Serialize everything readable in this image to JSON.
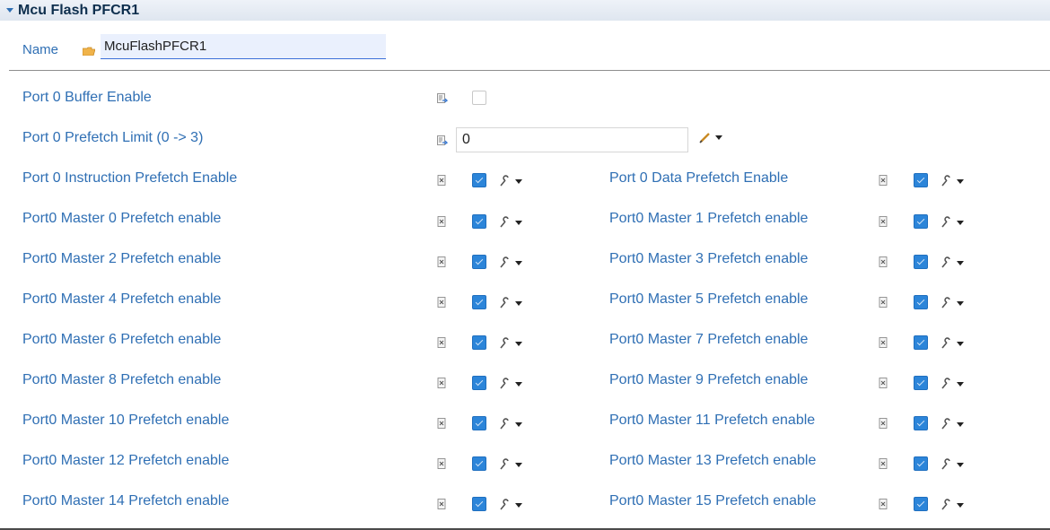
{
  "section": {
    "title": "Mcu Flash PFCR1"
  },
  "name_field": {
    "label": "Name",
    "value": "McuFlashPFCR1"
  },
  "buffer_enable": {
    "label": "Port 0 Buffer Enable",
    "checked": false
  },
  "prefetch_limit": {
    "label": "Port 0 Prefetch Limit (0 -> 3)",
    "value": "0"
  },
  "instruction_prefetch": {
    "label": "Port 0 Instruction Prefetch Enable",
    "checked": true
  },
  "data_prefetch": {
    "label": "Port 0 Data Prefetch Enable",
    "checked": true
  },
  "master_rows": [
    {
      "left": {
        "label": "Port0 Master 0 Prefetch enable",
        "checked": true
      },
      "right": {
        "label": "Port0 Master 1 Prefetch enable",
        "checked": true
      }
    },
    {
      "left": {
        "label": "Port0 Master 2 Prefetch enable",
        "checked": true
      },
      "right": {
        "label": "Port0 Master 3 Prefetch enable",
        "checked": true
      }
    },
    {
      "left": {
        "label": "Port0 Master 4 Prefetch enable",
        "checked": true
      },
      "right": {
        "label": "Port0 Master 5 Prefetch enable",
        "checked": true
      }
    },
    {
      "left": {
        "label": "Port0 Master 6 Prefetch enable",
        "checked": true
      },
      "right": {
        "label": "Port0 Master 7 Prefetch enable",
        "checked": true
      }
    },
    {
      "left": {
        "label": "Port0 Master 8 Prefetch enable",
        "checked": true
      },
      "right": {
        "label": "Port0 Master 9 Prefetch enable",
        "checked": true
      }
    },
    {
      "left": {
        "label": "Port0 Master 10 Prefetch enable",
        "checked": true
      },
      "right": {
        "label": "Port0 Master 11 Prefetch enable",
        "checked": true
      }
    },
    {
      "left": {
        "label": "Port0 Master 12 Prefetch enable",
        "checked": true
      },
      "right": {
        "label": "Port0 Master 13 Prefetch enable",
        "checked": true
      }
    },
    {
      "left": {
        "label": "Port0 Master 14 Prefetch enable",
        "checked": true
      },
      "right": {
        "label": "Port0 Master 15 Prefetch enable",
        "checked": true
      }
    }
  ],
  "icons": {
    "twisty": "expand-twisty-icon",
    "folder": "folder-icon",
    "doc": "parameter-doc-icon",
    "config": "configure-icon",
    "pencil": "edit-pencil-icon",
    "dropdown": "chevron-down-icon"
  },
  "colors": {
    "label": "#2f6fb4",
    "checkbox": "#2c85d9",
    "header_bg": "#dfe6f0"
  }
}
